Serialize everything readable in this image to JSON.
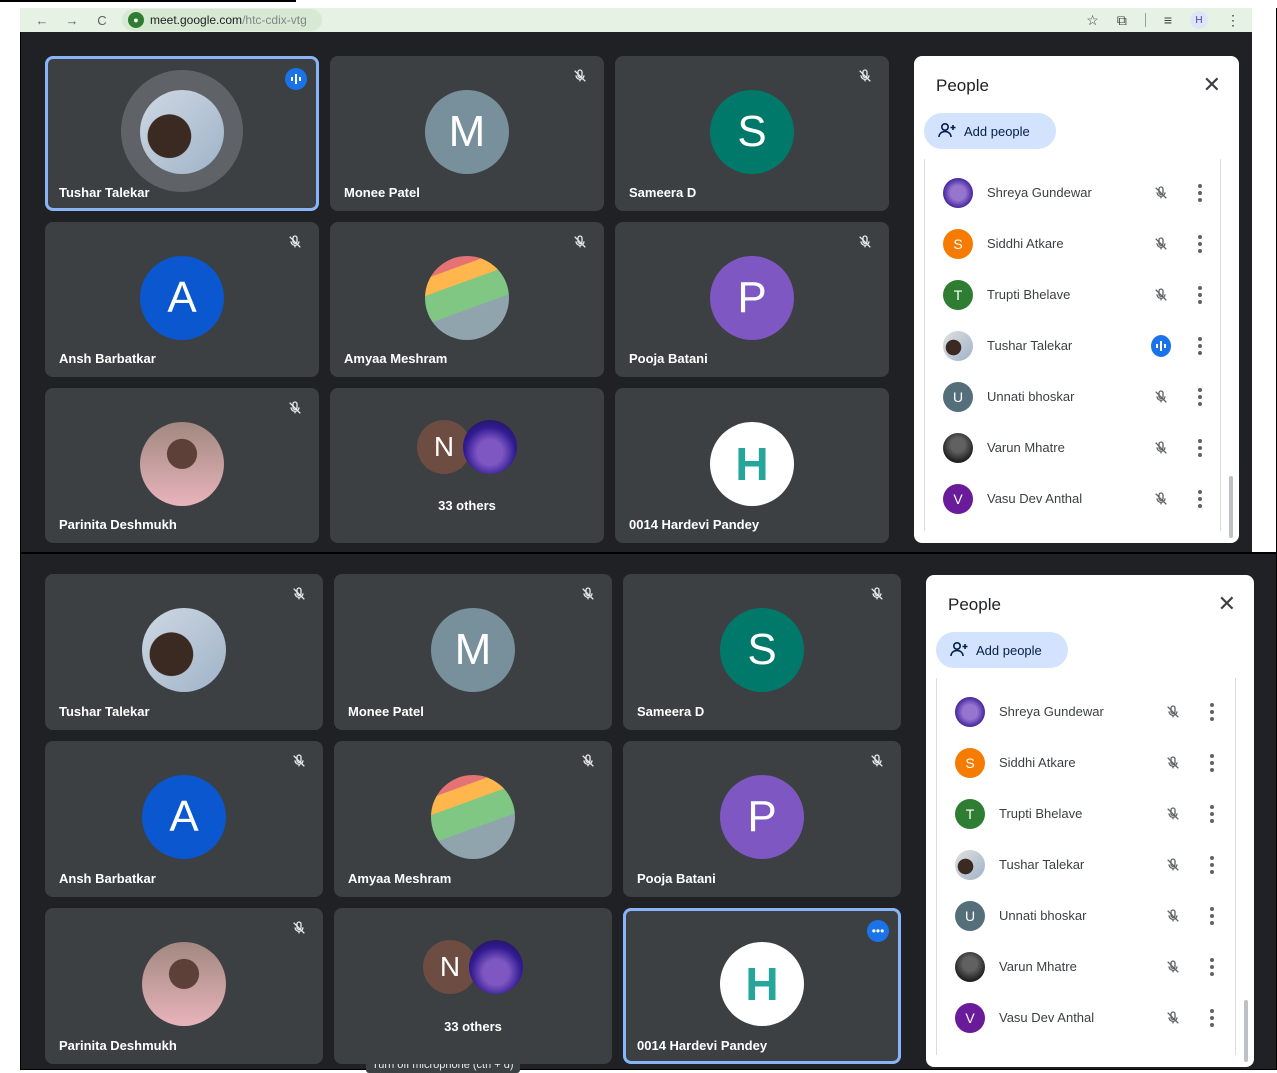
{
  "browser": {
    "url_host": "meet.google.com",
    "url_path": "/htc-cdix-vtg",
    "profile_initial": "H"
  },
  "top": {
    "tiles": [
      {
        "name": "Tushar Talekar",
        "kind": "photo-ring",
        "speaking": true
      },
      {
        "name": "Monee Patel",
        "kind": "letter",
        "letter": "M",
        "color": "#78909c"
      },
      {
        "name": "Sameera D",
        "kind": "letter",
        "letter": "S",
        "color": "#00796b"
      },
      {
        "name": "Ansh Barbatkar",
        "kind": "letter",
        "letter": "A",
        "color": "#0b57d0"
      },
      {
        "name": "Amyaa Meshram",
        "kind": "photo"
      },
      {
        "name": "Pooja Batani",
        "kind": "letter",
        "letter": "P",
        "color": "#7e57c2"
      },
      {
        "name": "Parinita Deshmukh",
        "kind": "photo"
      },
      {
        "others_label": "33 others",
        "kind": "others",
        "letter": "N"
      },
      {
        "name": "0014 Hardevi Pandey",
        "kind": "h-logo",
        "letter": "H"
      }
    ],
    "people_panel": {
      "title": "People",
      "add_label": "Add people",
      "close_glyph": "✕",
      "people": [
        {
          "name": "Shreya Gundewar",
          "avatar": "photo",
          "status": "muted"
        },
        {
          "name": "Siddhi Atkare",
          "avatar": "S",
          "color": "#f57c00",
          "status": "muted"
        },
        {
          "name": "Trupti Bhelave",
          "avatar": "T",
          "color": "#2e7d32",
          "status": "muted"
        },
        {
          "name": "Tushar Talekar",
          "avatar": "photo",
          "status": "speaking"
        },
        {
          "name": "Unnati bhoskar",
          "avatar": "U",
          "color": "#546e7a",
          "status": "muted"
        },
        {
          "name": "Varun Mhatre",
          "avatar": "photo",
          "status": "muted"
        },
        {
          "name": "Vasu Dev Anthal",
          "avatar": "V",
          "color": "#6a1b9a",
          "status": "muted"
        }
      ]
    }
  },
  "bottom": {
    "tiles": [
      {
        "name": "Tushar Talekar",
        "kind": "photo"
      },
      {
        "name": "Monee Patel",
        "kind": "letter",
        "letter": "M",
        "color": "#78909c"
      },
      {
        "name": "Sameera D",
        "kind": "letter",
        "letter": "S",
        "color": "#00796b"
      },
      {
        "name": "Ansh Barbatkar",
        "kind": "letter",
        "letter": "A",
        "color": "#0b57d0"
      },
      {
        "name": "Amyaa Meshram",
        "kind": "photo"
      },
      {
        "name": "Pooja Batani",
        "kind": "letter",
        "letter": "P",
        "color": "#7e57c2"
      },
      {
        "name": "Parinita Deshmukh",
        "kind": "photo"
      },
      {
        "others_label": "33 others",
        "kind": "others",
        "letter": "N"
      },
      {
        "name": "0014 Hardevi Pandey",
        "kind": "h-logo",
        "letter": "H",
        "active": true
      }
    ],
    "tooltip": "Turn off microphone (ctrl + d)",
    "people_panel": {
      "title": "People",
      "add_label": "Add people",
      "close_glyph": "✕",
      "people": [
        {
          "name": "Shreya Gundewar",
          "avatar": "photo",
          "status": "muted"
        },
        {
          "name": "Siddhi Atkare",
          "avatar": "S",
          "color": "#f57c00",
          "status": "muted"
        },
        {
          "name": "Trupti Bhelave",
          "avatar": "T",
          "color": "#2e7d32",
          "status": "muted"
        },
        {
          "name": "Tushar Talekar",
          "avatar": "photo",
          "status": "muted"
        },
        {
          "name": "Unnati bhoskar",
          "avatar": "U",
          "color": "#546e7a",
          "status": "muted"
        },
        {
          "name": "Varun Mhatre",
          "avatar": "photo",
          "status": "muted"
        },
        {
          "name": "Vasu Dev Anthal",
          "avatar": "V",
          "color": "#6a1b9a",
          "status": "muted"
        }
      ]
    }
  }
}
